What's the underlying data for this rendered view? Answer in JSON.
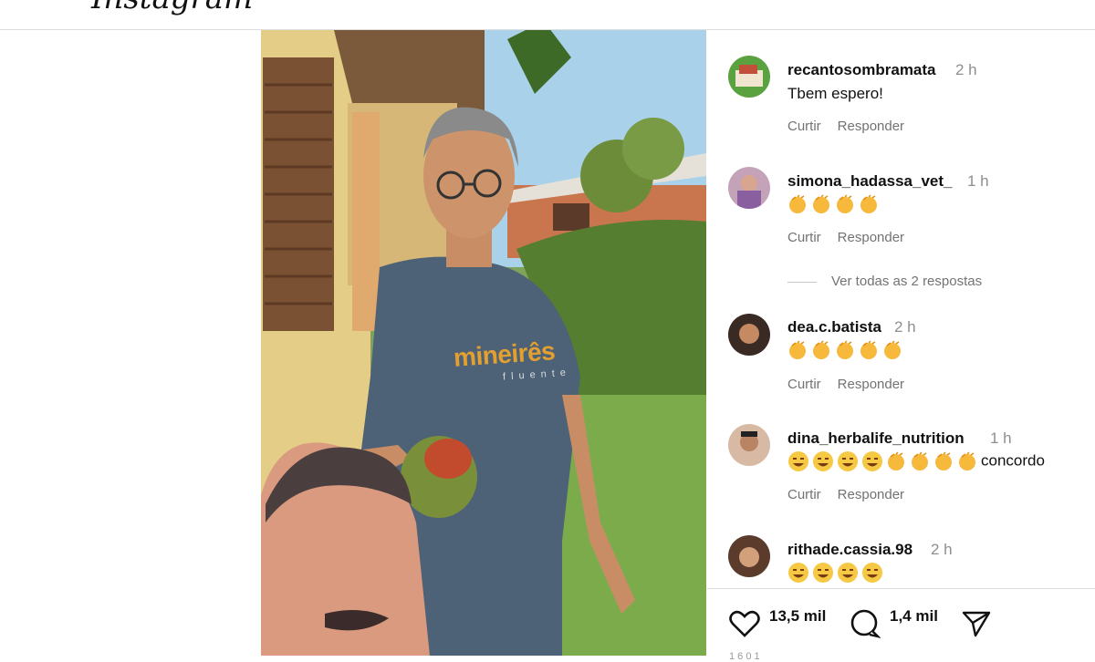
{
  "header": {
    "logo_text": "Instagram"
  },
  "post": {
    "shirt_brand": "mineirês",
    "shirt_sub": "fluente"
  },
  "comments": [
    {
      "username": "recantosombramata",
      "time": "2 h",
      "text": "Tbem espero!",
      "like_label": "Curtir",
      "reply_label": "Responder"
    },
    {
      "username": "simona_hadassa_vet_",
      "time": "1 h",
      "emojis": [
        "clap",
        "clap",
        "clap",
        "clap"
      ],
      "like_label": "Curtir",
      "reply_label": "Responder",
      "view_replies": "Ver todas as 2 respostas"
    },
    {
      "username": "dea.c.batista",
      "time": "2 h",
      "emojis": [
        "clap",
        "clap",
        "clap",
        "clap",
        "clap"
      ],
      "like_label": "Curtir",
      "reply_label": "Responder"
    },
    {
      "username": "dina_herbalife_nutrition",
      "time": "1 h",
      "emojis": [
        "laugh",
        "laugh",
        "laugh",
        "laugh",
        "clap",
        "clap",
        "clap",
        "clap"
      ],
      "text": "concordo",
      "like_label": "Curtir",
      "reply_label": "Responder"
    },
    {
      "username": "rithade.cassia.98",
      "time": "2 h",
      "emojis": [
        "laugh",
        "laugh",
        "laugh",
        "laugh"
      ]
    }
  ],
  "footer": {
    "likes": "13,5 mil",
    "comments": "1,4 mil",
    "like_icon": "heart-icon",
    "comment_icon": "comment-bubble-icon",
    "share_icon": "send-icon",
    "cut_text": "1 6  0 1"
  },
  "colors": {
    "muted": "#8e8e8e",
    "action": "#737373",
    "shirt_text": "#e3a030"
  }
}
